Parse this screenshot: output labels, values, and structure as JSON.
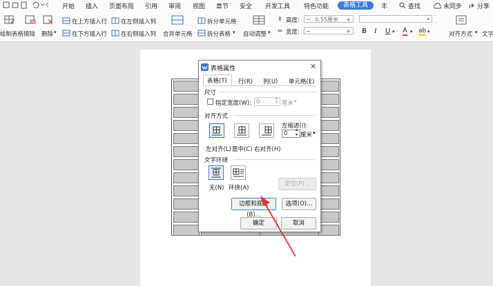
{
  "menubar": {
    "items": [
      "开始",
      "插入",
      "页面布局",
      "引用",
      "审阅",
      "视图",
      "章节",
      "安全",
      "开发工具",
      "特色功能"
    ],
    "active_tab": "表格工具",
    "overflow": "丰",
    "search": "查找",
    "sync": "未同步",
    "share": "分享"
  },
  "ribbon": {
    "draw_table": "绘制表格",
    "erase": "擦除",
    "delete": "删除",
    "insert_above": "在上方插入行",
    "insert_below": "在下方插入行",
    "insert_left": "在左侧插入列",
    "insert_right": "在右侧插入列",
    "merge_cells": "合并单元格",
    "split_cells": "拆分单元格",
    "split_table": "拆分表格",
    "auto_fit": "自动调整",
    "height_label": "高度:",
    "height_value": "0.55厘米",
    "width_label": "宽度:",
    "width_value": "",
    "font_bold": "B",
    "font_italic": "I",
    "font_underline": "U",
    "font_color": "A",
    "highlight": "ab",
    "align_mode": "对齐方式",
    "text_dir": "文字"
  },
  "dialog": {
    "title": "表格属性",
    "tabs": [
      "表格(T)",
      "行(R)",
      "列(U)",
      "单元格(E)"
    ],
    "section_size": "尺寸",
    "specify_width": "指定宽度(W):",
    "width_value": "0",
    "width_unit": "厘米",
    "section_align": "对齐方式",
    "indent_label": "左缩进(I):",
    "indent_value": "0",
    "indent_unit": "厘米",
    "align_left": "左对齐(L)",
    "align_center": "居中(C)",
    "align_right": "右对齐(H)",
    "section_wrap": "文字环绕",
    "wrap_none": "无(N)",
    "wrap_around": "环绕(A)",
    "position_button": "定位(P)...",
    "borders_button": "边框和底纹(B)...",
    "options_button": "选项(O)...",
    "ok_button": "确定",
    "cancel_button": "取消"
  },
  "colors": {
    "accent": "#3b7cd6",
    "arrow": "#e03a2f"
  }
}
